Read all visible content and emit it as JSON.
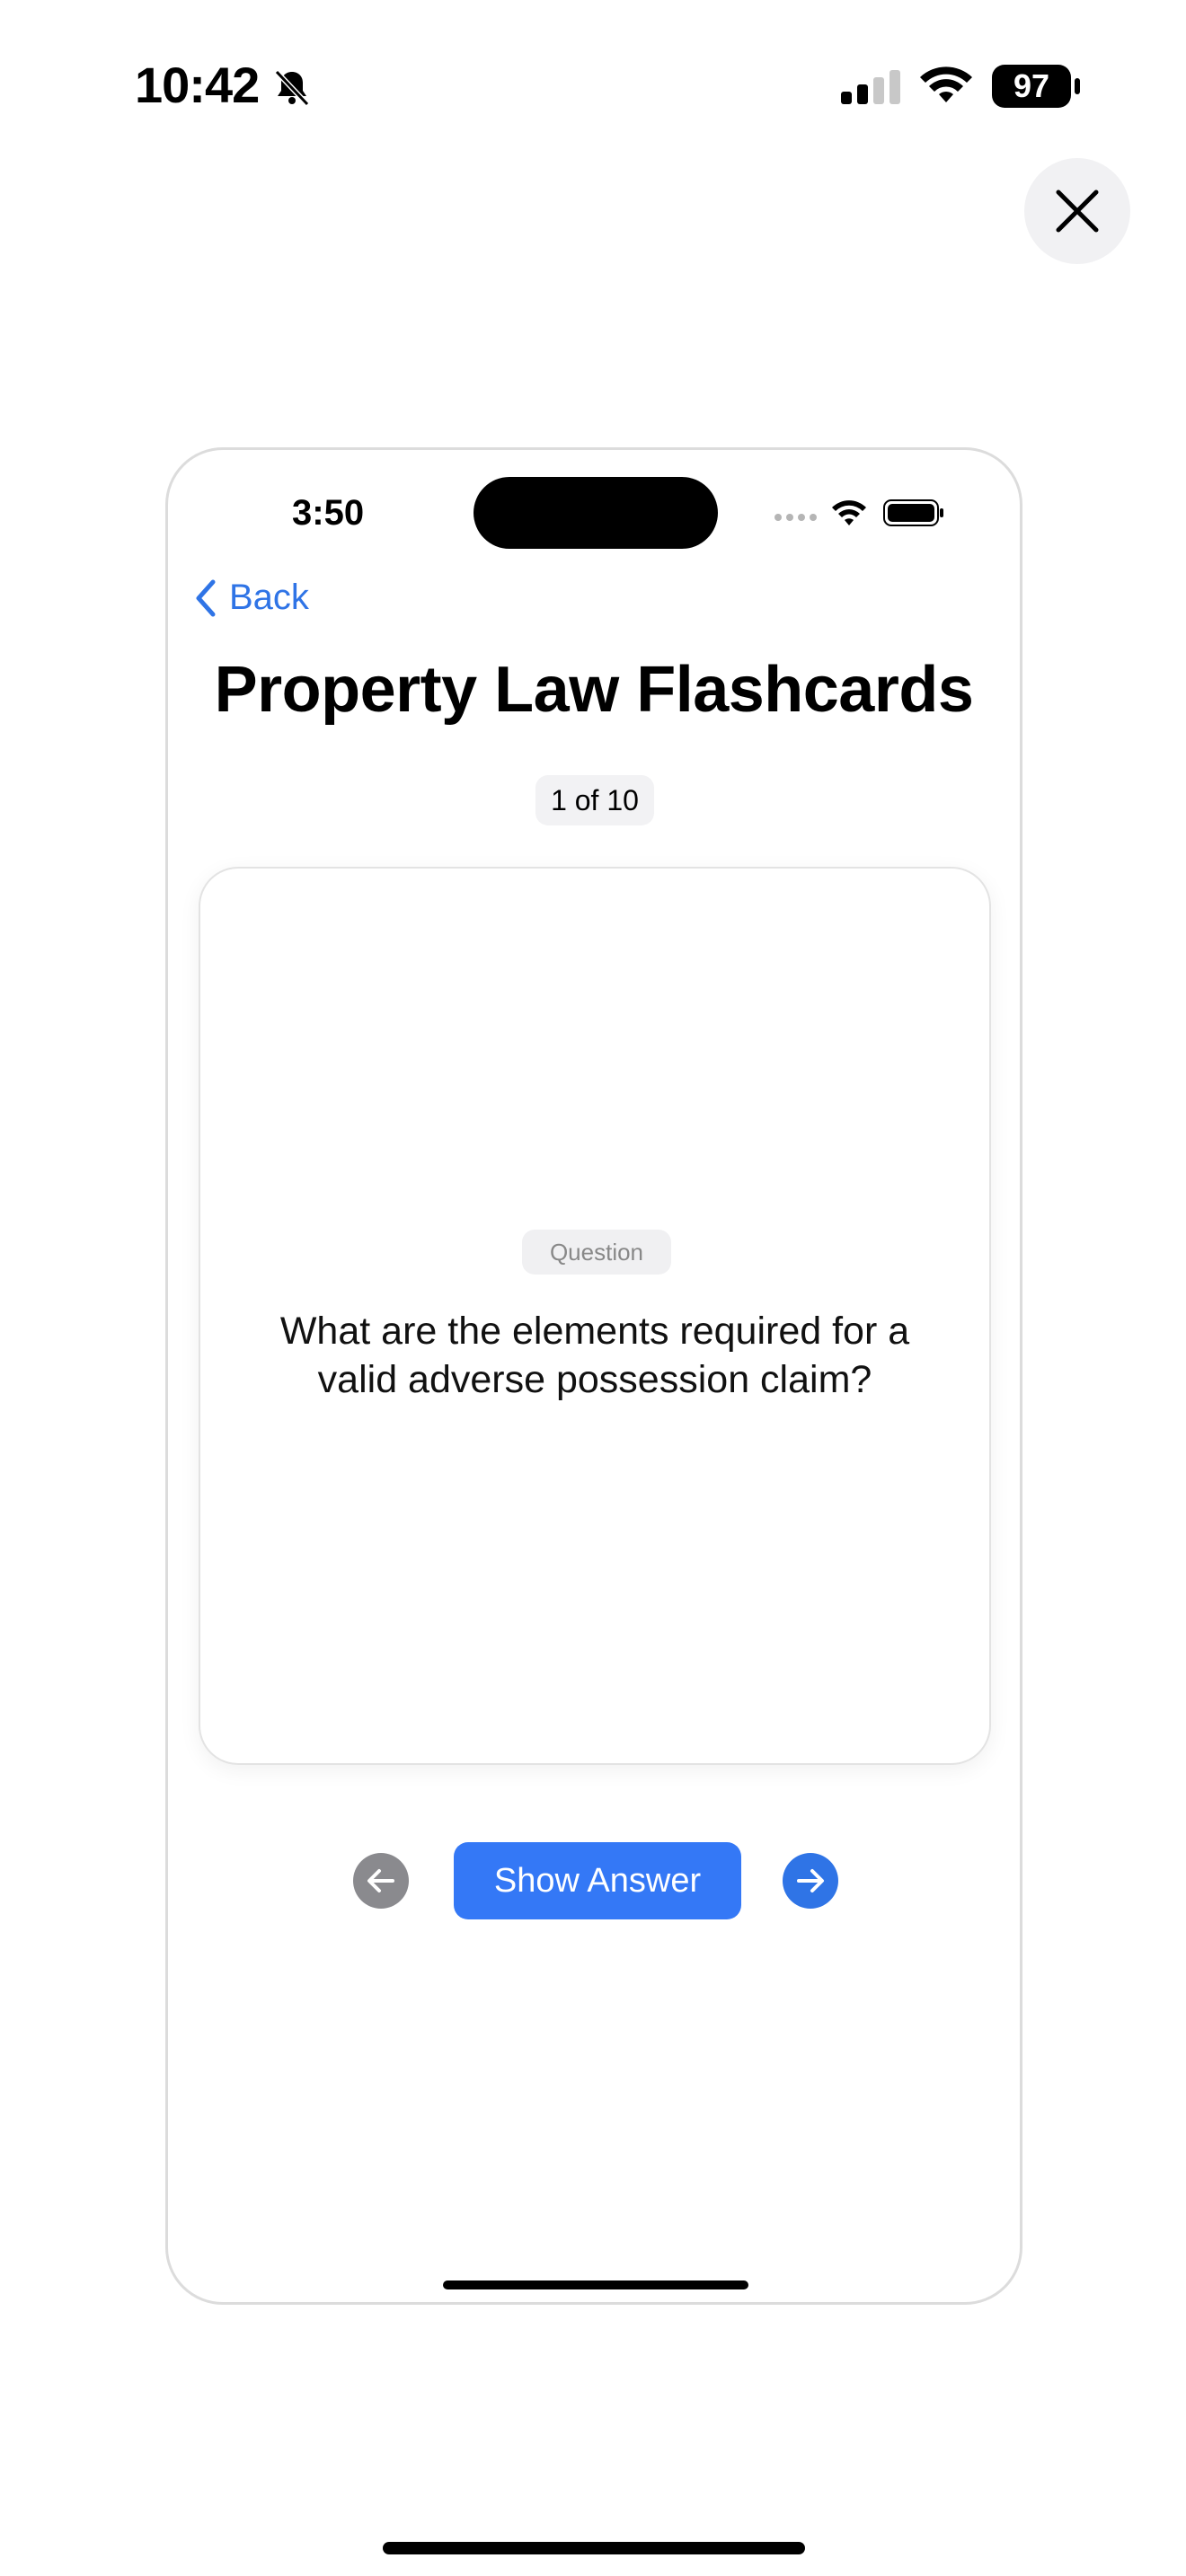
{
  "status_bar": {
    "time": "10:42",
    "battery": "97",
    "icons": [
      "bell-slash-icon",
      "signal-icon",
      "wifi-icon",
      "battery-icon"
    ]
  },
  "close_button": {
    "icon": "close-icon"
  },
  "preview": {
    "status_bar": {
      "time": "3:50",
      "icons": [
        "signal-dots-icon",
        "wifi-icon",
        "battery-icon"
      ]
    },
    "back_label": "Back",
    "title": "Property Law Flashcards",
    "counter": "1 of 10",
    "card": {
      "label": "Question",
      "text": "What are the elements required for a valid adverse possession claim?"
    },
    "controls": {
      "prev_icon": "arrow-left-icon",
      "show_answer_label": "Show Answer",
      "next_icon": "arrow-right-icon"
    }
  },
  "colors": {
    "accent": "#3478f6",
    "link": "#2f74e6",
    "disabled": "#8a8a8e",
    "pill_bg": "#f2f2f4"
  }
}
